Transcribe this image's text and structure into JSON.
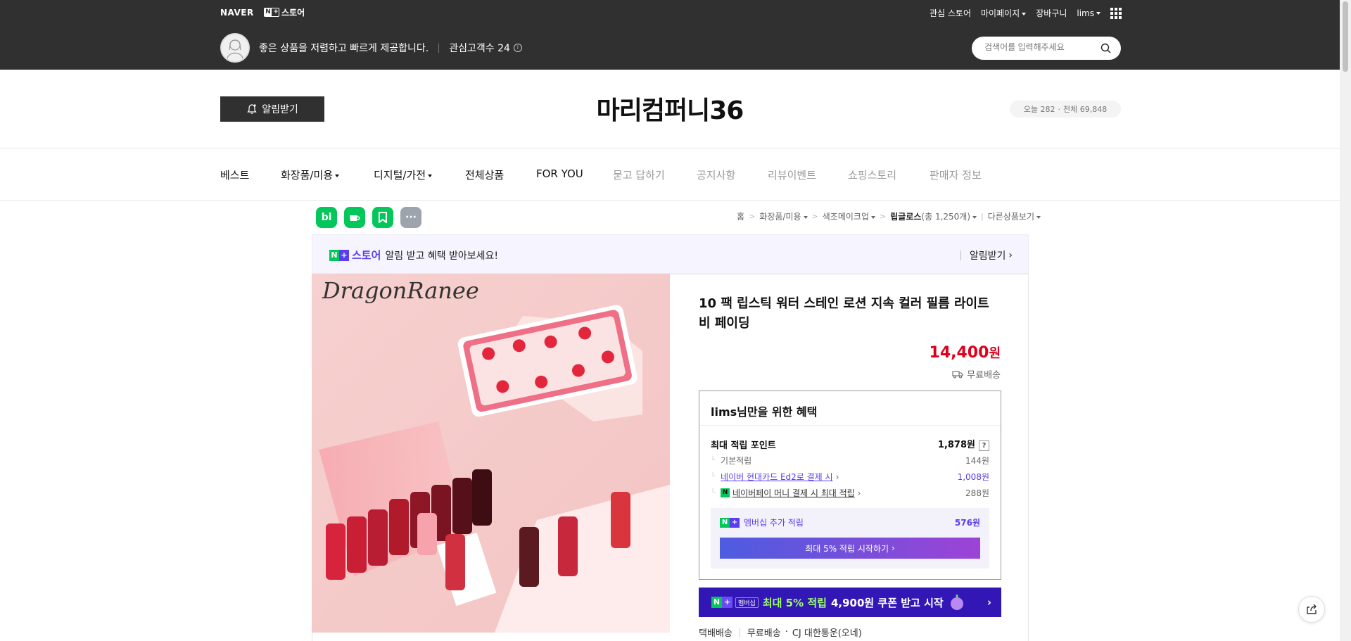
{
  "topbar": {
    "naver_logo": "NAVER",
    "store_label": "스토어",
    "links": {
      "favorite_store": "관심 스토어",
      "mypage": "마이페이지",
      "cart": "장바구니",
      "user": "lims"
    },
    "slogan": "좋은 상품을 저렴하고 빠르게 제공합니다.",
    "followers_label": "관심고객수 24",
    "search_placeholder": "검색어를 입력해주세요"
  },
  "store": {
    "alarm_button": "알림받기",
    "name": "마리컴퍼니36",
    "visit_today": "오늘 282",
    "visit_total": "전체 69,848"
  },
  "nav": {
    "items": [
      "베스트",
      "화장품/미용",
      "디지털/가전",
      "전체상품",
      "FOR YOU",
      "묻고 답하기",
      "공지사항",
      "리뷰이벤트",
      "쇼핑스토리",
      "판매자 정보"
    ]
  },
  "share": {
    "blog_label": "bl"
  },
  "breadcrumb": {
    "home": "홈",
    "cat1": "화장품/미용",
    "cat2": "색조메이크업",
    "cat3": "립글로스",
    "count": "(총 1,250개)",
    "other": "다른상품보기"
  },
  "promo": {
    "store_word": "스토어",
    "text": "알림 받고 혜택 받아보세요!",
    "action": "알림받기"
  },
  "product": {
    "image_brand": "DragonRanee",
    "title": "10 팩 립스틱 워터 스테인 로션 지속 컬러 필름 라이트 비 페이딩",
    "price": "14,400",
    "currency": "원",
    "shipping": "무료배송"
  },
  "benefit": {
    "heading": "lims님만을 위한 혜택",
    "max_point_label": "최대 적립 포인트",
    "max_point_value": "1,878원",
    "help": "?",
    "basic_label": "기본적립",
    "basic_value": "144원",
    "card_label": "네이버 현대카드 Ed2로 결제 시",
    "card_value": "1,008원",
    "npay_label": "네이버페이 머니 결제 시 최대 적립",
    "npay_value": "288원",
    "membership_label": "멤버십 추가 적립",
    "membership_value": "576원",
    "membership_button": "최대 5% 적립 시작하기"
  },
  "banner": {
    "tag": "멤버십",
    "highlight": "최대 5% 적립",
    "text": "4,900원 쿠폰 받고 시작"
  },
  "delivery": {
    "type": "택배배송",
    "fee": "무료배송",
    "carrier": "CJ 대한통운(오네)"
  },
  "colors": {
    "topbar": "#303030",
    "price": "#e0001b",
    "accent_purple": "#5a3df0",
    "naver_green": "#03c75a"
  }
}
